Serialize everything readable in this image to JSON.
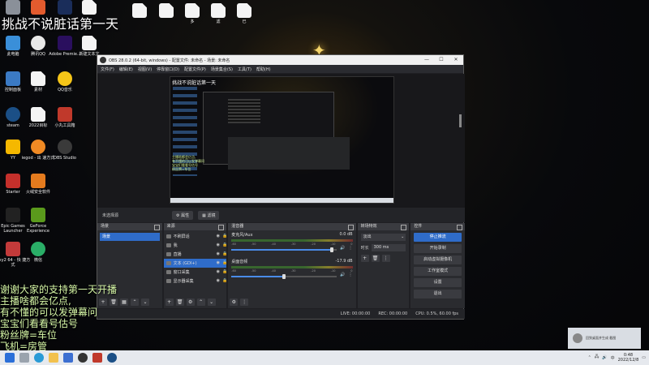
{
  "overlay": {
    "title": "挑战不说脏话第一天",
    "lines": [
      "谢谢大家的支持第一天开播",
      "主播啥都会亿点,",
      "有不懂的可以发弹幕问",
      "宝宝们看看号估号",
      "粉丝牌=车位",
      "飞机=房管"
    ]
  },
  "desktop_icons": [
    {
      "label": "此电脑"
    },
    {
      "label": "腾讯QQ"
    },
    {
      "label": "Adobe Premie..."
    },
    {
      "label": "新建文本文"
    },
    {
      "label": "控制面板"
    },
    {
      "label": "素材"
    },
    {
      "label": "QQ音乐"
    },
    {
      "label": "steam"
    },
    {
      "label": "2022目标"
    },
    {
      "label": "小丸工具箱"
    },
    {
      "label": "YY"
    },
    {
      "label": "iegod - 出 速方式"
    },
    {
      "label": "OBS Studio"
    },
    {
      "label": "Starter"
    },
    {
      "label": "火绒安全软件"
    },
    {
      "label": "Epic Games Launcher"
    },
    {
      "label": "GeForce Experience"
    },
    {
      "label": "Oxy2 64 - 快 捷方式"
    },
    {
      "label": "微信"
    }
  ],
  "top_files": [
    {
      "label": ""
    },
    {
      "label": ""
    },
    {
      "label": "多"
    },
    {
      "label": "滤"
    },
    {
      "label": "已"
    }
  ],
  "obs": {
    "title": "OBS 28.0.2 (64-bit, windows) - 配置文件: 未命名 - 场景: 未命名",
    "menu": [
      "文件(F)",
      "编辑(E)",
      "视图(V)",
      "停靠窗口(D)",
      "配置文件(P)",
      "场景集合(S)",
      "工具(T)",
      "帮助(H)"
    ],
    "preview_caption": "挑战不说脏话第一天",
    "source_selected": "未选择源",
    "props_button": "属性",
    "filters_button": "滤镜",
    "docks": {
      "scenes": {
        "title": "场景",
        "items": [
          "场景"
        ]
      },
      "sources": {
        "title": "来源",
        "items": [
          {
            "label": "不刷屏话"
          },
          {
            "label": "我"
          },
          {
            "label": "直播"
          },
          {
            "label": "文本 (GDI+)",
            "selected": true
          },
          {
            "label": "窗口采集"
          },
          {
            "label": "显示器采集"
          }
        ]
      },
      "mixer": {
        "title": "混音器",
        "channels": [
          {
            "name": "麦克风/Aux",
            "db": "0.0 dB",
            "level": 0.95
          },
          {
            "name": "桌面音频",
            "db": "-17.9 dB",
            "level": 0.5
          }
        ],
        "ticks": [
          "-60",
          "-55",
          "-50",
          "-45",
          "-40",
          "-35",
          "-30",
          "-25",
          "-20",
          "-15",
          "-10",
          "-5",
          "0"
        ]
      },
      "transitions": {
        "title": "转场特效",
        "selected": "淡出",
        "duration_label": "时长",
        "duration": "300 ms"
      },
      "controls": {
        "title": "控件",
        "buttons": [
          "停止推流",
          "开始录制",
          "启动虚拟摄像机",
          "工作室模式",
          "设置",
          "退出"
        ]
      }
    },
    "status": {
      "live": "LIVE: 00:00:00",
      "rec": "REC: 00:00:00",
      "cpu": "CPU: 0.5%, 60.00 fps"
    }
  },
  "notification": {
    "text": "回到桌面并生成 截图"
  },
  "clock": {
    "time": "0:48",
    "date": "2022/12/8"
  }
}
